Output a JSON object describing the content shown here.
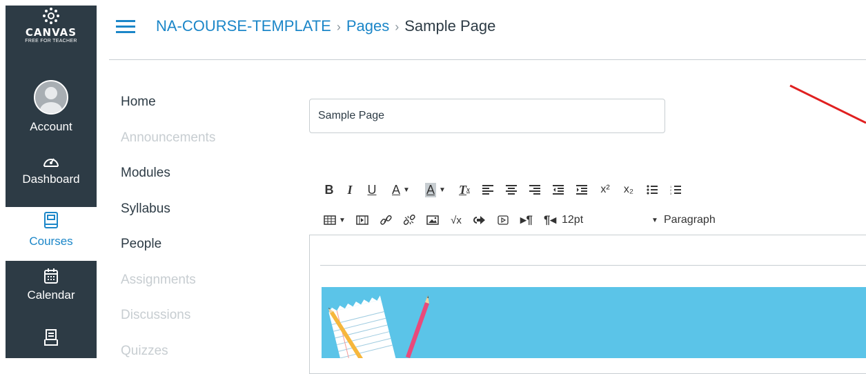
{
  "global_nav": {
    "logo": {
      "wordmark": "CANVAS",
      "sub": "FREE FOR TEACHER"
    },
    "items": [
      {
        "label": "Account",
        "icon": "avatar"
      },
      {
        "label": "Dashboard",
        "icon": "dashboard-icon"
      },
      {
        "label": "Courses",
        "icon": "courses-icon",
        "active": true
      },
      {
        "label": "Calendar",
        "icon": "calendar-icon"
      },
      {
        "label": "Inbox",
        "icon": "inbox-icon"
      }
    ],
    "colors": {
      "background": "#2d3b45",
      "active_text": "#1b86c8"
    }
  },
  "header": {
    "breadcrumbs": [
      "NA-COURSE-TEMPLATE",
      "Pages",
      "Sample Page"
    ],
    "separator": "›"
  },
  "course_nav": {
    "items": [
      {
        "label": "Home",
        "enabled": true
      },
      {
        "label": "Announcements",
        "enabled": false
      },
      {
        "label": "Modules",
        "enabled": true
      },
      {
        "label": "Syllabus",
        "enabled": true
      },
      {
        "label": "People",
        "enabled": true
      },
      {
        "label": "Assignments",
        "enabled": false
      },
      {
        "label": "Discussions",
        "enabled": false
      },
      {
        "label": "Quizzes",
        "enabled": false
      }
    ]
  },
  "editor": {
    "title_value": "Sample Page",
    "toolbar": {
      "bold": "B",
      "italic": "I",
      "underline": "U",
      "font_color": "A",
      "background_color": "A",
      "clear_formatting": "T",
      "font_size": "12pt",
      "format": "Paragraph"
    }
  }
}
